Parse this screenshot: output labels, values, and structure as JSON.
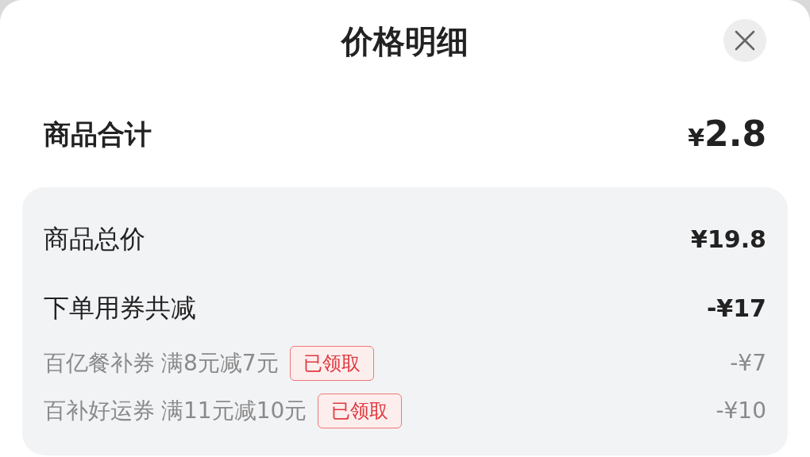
{
  "header": {
    "title": "价格明细"
  },
  "subtotal": {
    "label": "商品合计",
    "currency": "¥",
    "amount": "2.8"
  },
  "details": [
    {
      "kind": "main",
      "label": "商品总价",
      "amount": "¥19.8"
    },
    {
      "kind": "main",
      "label": "下单用券共减",
      "amount": "-¥17"
    },
    {
      "kind": "coupon",
      "label": "百亿餐补券",
      "condition": "满8元减7元",
      "badge": "已领取",
      "amount": "-¥7"
    },
    {
      "kind": "coupon",
      "label": "百补好运券",
      "condition": "满11元减10元",
      "badge": "已领取",
      "amount": "-¥10"
    }
  ]
}
